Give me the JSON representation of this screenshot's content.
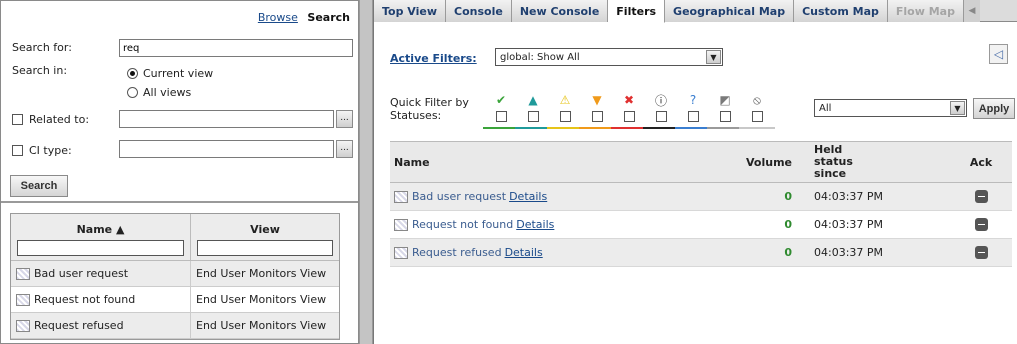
{
  "left": {
    "browse_label": "Browse",
    "search_label": "Search",
    "search_for_label": "Search for:",
    "search_for_value": "req",
    "search_in_label": "Search in:",
    "radio_current": "Current view",
    "radio_all": "All views",
    "related_label": "Related to:",
    "ci_type_label": "CI type:",
    "dots": "...",
    "search_button": "Search",
    "results": {
      "col_name": "Name ▲",
      "col_view": "View",
      "rows": [
        {
          "name": "Bad user request",
          "view": "End User Monitors View"
        },
        {
          "name": "Request not found",
          "view": "End User Monitors View"
        },
        {
          "name": "Request refused",
          "view": "End User Monitors View"
        }
      ]
    }
  },
  "tabs": [
    {
      "label": "Top View"
    },
    {
      "label": "Console"
    },
    {
      "label": "New Console"
    },
    {
      "label": "Filters"
    },
    {
      "label": "Geographical Map"
    },
    {
      "label": "Custom Map"
    },
    {
      "label": "Flow Map"
    }
  ],
  "filters": {
    "active_filters_label": "Active Filters:",
    "active_filters_value": "global: Show All",
    "quick_filter_label_1": "Quick Filter by",
    "quick_filter_label_2": "Statuses:",
    "status_select_value": "All",
    "apply_button": "Apply",
    "statuses": [
      {
        "icon": "ok-icon",
        "glyph": "✔",
        "color": "#3aa43a"
      },
      {
        "icon": "warning-teal-icon",
        "glyph": "▲",
        "color": "#1f9a9a"
      },
      {
        "icon": "warning-yellow-icon",
        "glyph": "⚠",
        "color": "#e6c419"
      },
      {
        "icon": "warning-orange-icon",
        "glyph": "▼",
        "color": "#f09a1a"
      },
      {
        "icon": "error-icon",
        "glyph": "✖",
        "color": "#e03030"
      },
      {
        "icon": "info-icon",
        "glyph": "ⓘ",
        "color": "#222222"
      },
      {
        "icon": "question-icon",
        "glyph": "?",
        "color": "#3a7ed0"
      },
      {
        "icon": "unknown-icon",
        "glyph": "◩",
        "color": "#7a7a7a"
      },
      {
        "icon": "disabled-icon",
        "glyph": "⦸",
        "color": "#555555"
      }
    ],
    "bar_colors": [
      "#3aa43a",
      "#1f9a9a",
      "#e6c419",
      "#f09a1a",
      "#e03030",
      "#222222",
      "#3a7ed0",
      "#9a9a9a",
      "#c8c8c8"
    ]
  },
  "events": {
    "col_name": "Name",
    "col_volume": "Volume",
    "col_held_1": "Held",
    "col_held_2": "status",
    "col_held_3": "since",
    "col_ack": "Ack",
    "details_label": "Details",
    "rows": [
      {
        "name": "Bad user request",
        "volume": "0",
        "time": "04:03:37 PM"
      },
      {
        "name": "Request not found",
        "volume": "0",
        "time": "04:03:37 PM"
      },
      {
        "name": "Request refused",
        "volume": "0",
        "time": "04:03:37 PM"
      }
    ]
  }
}
